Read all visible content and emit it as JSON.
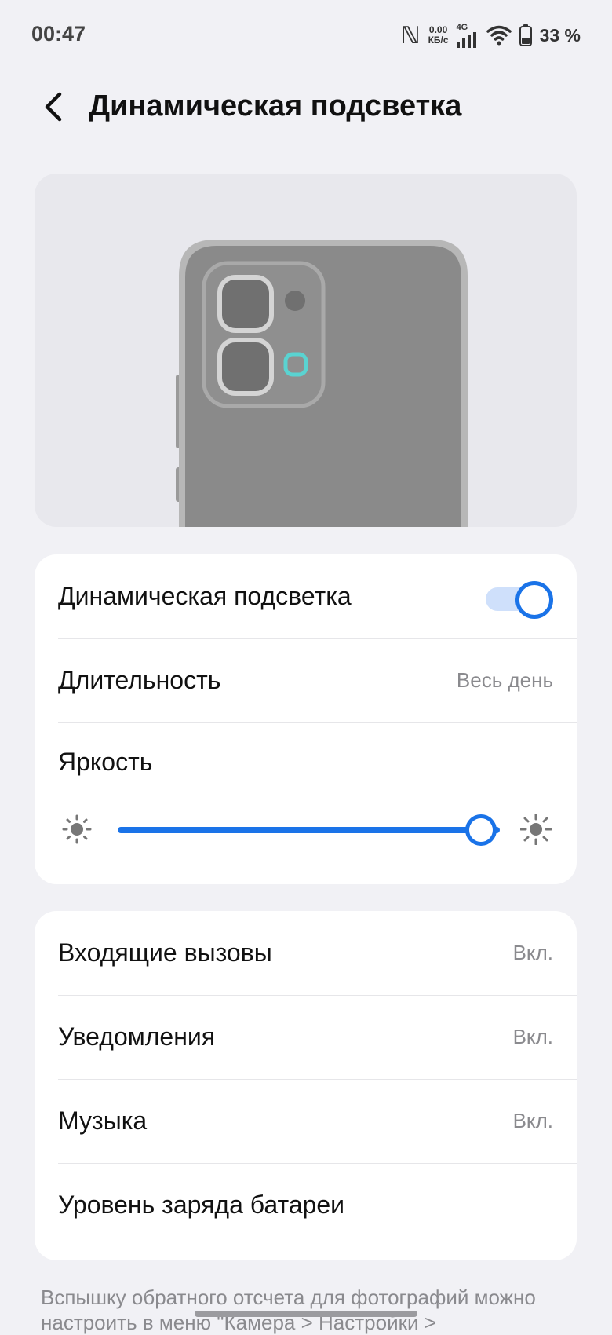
{
  "status_bar": {
    "time": "00:47",
    "speed_value": "0.00",
    "speed_unit": "КБ/с",
    "network": "4G",
    "battery": "33 %",
    "icons": [
      "nfc-icon",
      "signal-icon",
      "wifi-icon",
      "battery-icon"
    ]
  },
  "header": {
    "title": "Динамическая подсветка",
    "back_icon": "chevron-left-icon"
  },
  "preview": {
    "accent_color": "#5ad3d1"
  },
  "settings_main": {
    "toggle_row": {
      "label": "Динамическая подсветка",
      "enabled": true
    },
    "duration_row": {
      "label": "Длительность",
      "value": "Весь день"
    },
    "brightness": {
      "label": "Яркость",
      "level": 0.95,
      "icon_low": "sun-small-icon",
      "icon_high": "sun-large-icon"
    }
  },
  "notifications": {
    "rows": [
      {
        "label": "Входящие вызовы",
        "value": "Вкл."
      },
      {
        "label": "Уведомления",
        "value": "Вкл."
      },
      {
        "label": "Музыка",
        "value": "Вкл."
      },
      {
        "label": "Уровень заряда батареи",
        "value": ""
      }
    ]
  },
  "footer": {
    "note": "Вспышку обратного отсчета для фотографий можно настроить в меню \"Камера > Настройки >"
  },
  "colors": {
    "accent": "#1a73e8",
    "background": "#f1f1f5",
    "card": "#ffffff"
  }
}
